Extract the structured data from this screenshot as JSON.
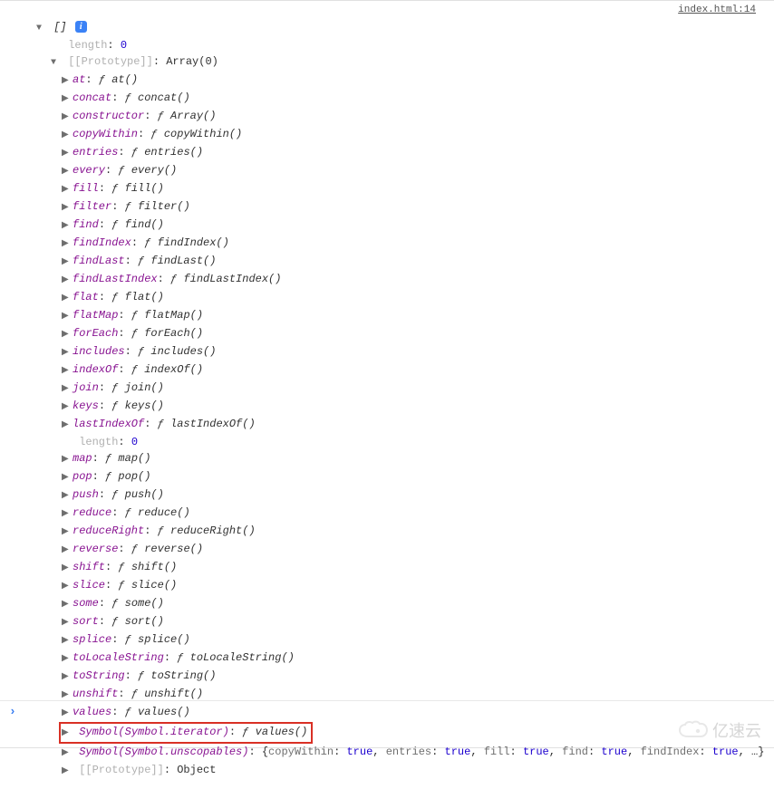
{
  "source_link": "index.html:14",
  "root": {
    "display": "[]",
    "info_badge": "i"
  },
  "length_label": "length",
  "length_value": "0",
  "prototype_label": "[[Prototype]]",
  "prototype_value": "Array(0)",
  "inner_length_label": "length",
  "inner_length_value": "0",
  "inner_prototype_label": "[[Prototype]]",
  "inner_prototype_value": "Object",
  "methods": [
    {
      "key": "at",
      "fn": "at()"
    },
    {
      "key": "concat",
      "fn": "concat()"
    },
    {
      "key": "constructor",
      "fn": "Array()"
    },
    {
      "key": "copyWithin",
      "fn": "copyWithin()"
    },
    {
      "key": "entries",
      "fn": "entries()"
    },
    {
      "key": "every",
      "fn": "every()"
    },
    {
      "key": "fill",
      "fn": "fill()"
    },
    {
      "key": "filter",
      "fn": "filter()"
    },
    {
      "key": "find",
      "fn": "find()"
    },
    {
      "key": "findIndex",
      "fn": "findIndex()"
    },
    {
      "key": "findLast",
      "fn": "findLast()"
    },
    {
      "key": "findLastIndex",
      "fn": "findLastIndex()"
    },
    {
      "key": "flat",
      "fn": "flat()"
    },
    {
      "key": "flatMap",
      "fn": "flatMap()"
    },
    {
      "key": "forEach",
      "fn": "forEach()"
    },
    {
      "key": "includes",
      "fn": "includes()"
    },
    {
      "key": "indexOf",
      "fn": "indexOf()"
    },
    {
      "key": "join",
      "fn": "join()"
    },
    {
      "key": "keys",
      "fn": "keys()"
    },
    {
      "key": "lastIndexOf",
      "fn": "lastIndexOf()"
    }
  ],
  "methods2": [
    {
      "key": "map",
      "fn": "map()"
    },
    {
      "key": "pop",
      "fn": "pop()"
    },
    {
      "key": "push",
      "fn": "push()"
    },
    {
      "key": "reduce",
      "fn": "reduce()"
    },
    {
      "key": "reduceRight",
      "fn": "reduceRight()"
    },
    {
      "key": "reverse",
      "fn": "reverse()"
    },
    {
      "key": "shift",
      "fn": "shift()"
    },
    {
      "key": "slice",
      "fn": "slice()"
    },
    {
      "key": "some",
      "fn": "some()"
    },
    {
      "key": "sort",
      "fn": "sort()"
    },
    {
      "key": "splice",
      "fn": "splice()"
    },
    {
      "key": "toLocaleString",
      "fn": "toLocaleString()"
    },
    {
      "key": "toString",
      "fn": "toString()"
    },
    {
      "key": "unshift",
      "fn": "unshift()"
    },
    {
      "key": "values",
      "fn": "values()"
    }
  ],
  "symbol_iterator": {
    "key": "Symbol(Symbol.iterator)",
    "fn": "values()"
  },
  "symbol_unscopables": {
    "key": "Symbol(Symbol.unscopables)",
    "preview_pairs": [
      {
        "k": "copyWithin",
        "v": "true"
      },
      {
        "k": "entries",
        "v": "true"
      },
      {
        "k": "fill",
        "v": "true"
      },
      {
        "k": "find",
        "v": "true"
      },
      {
        "k": "findIndex",
        "v": "true"
      }
    ],
    "trail": ", …}"
  },
  "watermark_text": "亿速云"
}
